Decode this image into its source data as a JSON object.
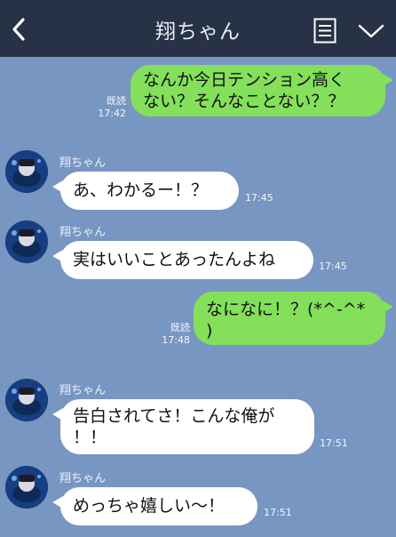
{
  "header": {
    "title": "翔ちゃん",
    "back_icon": "chevron-left-icon",
    "menu_icon": "notes-icon",
    "more_icon": "chevron-down-icon"
  },
  "colors": {
    "header_bg": "#273246",
    "chat_bg": "#7896c2",
    "my_bubble": "#84e05b",
    "their_bubble": "#ffffff"
  },
  "messages": [
    {
      "from": "me",
      "lines": [
        "なんか今日テンション高く",
        "ない？そんなことない？？"
      ],
      "read": "既読",
      "time": "17:42"
    },
    {
      "from": "them",
      "sender": "翔ちゃん",
      "lines": [
        "あ、わかるー！？"
      ],
      "time": "17:45"
    },
    {
      "from": "them",
      "sender": "翔ちゃん",
      "lines": [
        "実はいいことあったんよね"
      ],
      "time": "17:45"
    },
    {
      "from": "me",
      "lines": [
        "なになに！？(*^-^*",
        ")"
      ],
      "read": "既読",
      "time": "17:48"
    },
    {
      "from": "them",
      "sender": "翔ちゃん",
      "lines": [
        "告白されてさ！こんな俺が",
        "！！"
      ],
      "time": "17:51"
    },
    {
      "from": "them",
      "sender": "翔ちゃん",
      "lines": [
        "めっちゃ嬉しい〜！"
      ],
      "time": "17:51"
    }
  ]
}
